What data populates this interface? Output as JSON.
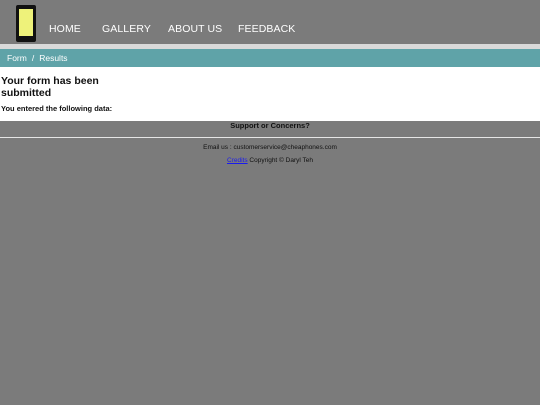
{
  "nav": {
    "items": [
      {
        "label": "HOME"
      },
      {
        "label": "GALLERY"
      },
      {
        "label": "ABOUT US"
      },
      {
        "label": "FEEDBACK"
      }
    ]
  },
  "breadcrumb": {
    "items": [
      "Form",
      "Results"
    ],
    "separator": "/"
  },
  "content": {
    "heading": "Your form has been submitted",
    "subtext": "You entered the following data:"
  },
  "support": {
    "label": "Support or Concerns?"
  },
  "footer": {
    "email_label": "Email us : customerservice@cheaphones.com",
    "credits_link": "Credits",
    "copyright": "Copyright © Daryl Teh"
  },
  "colors": {
    "background": "#7b7b7b",
    "breadcrumb_bg": "#5fa3a8",
    "logo_screen": "#eef27a"
  }
}
